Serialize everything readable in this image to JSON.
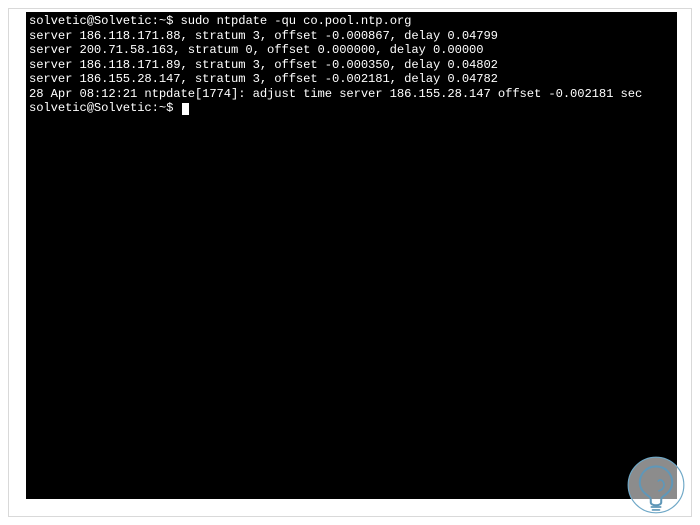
{
  "terminal": {
    "prompt1": {
      "user_host": "solvetic@Solvetic",
      "path_separator": ":~$",
      "command": "sudo ntpdate -qu co.pool.ntp.org"
    },
    "output": [
      "server 186.118.171.88, stratum 3, offset -0.000867, delay 0.04799",
      "server 200.71.58.163, stratum 0, offset 0.000000, delay 0.00000",
      "server 186.118.171.89, stratum 3, offset -0.000350, delay 0.04802",
      "server 186.155.28.147, stratum 3, offset -0.002181, delay 0.04782",
      "28 Apr 08:12:21 ntpdate[1774]: adjust time server 186.155.28.147 offset -0.002181 sec"
    ],
    "prompt2": {
      "user_host": "solvetic@Solvetic",
      "path_separator": ":~$",
      "command": ""
    }
  },
  "watermark": {
    "name": "solvetic-logo"
  }
}
